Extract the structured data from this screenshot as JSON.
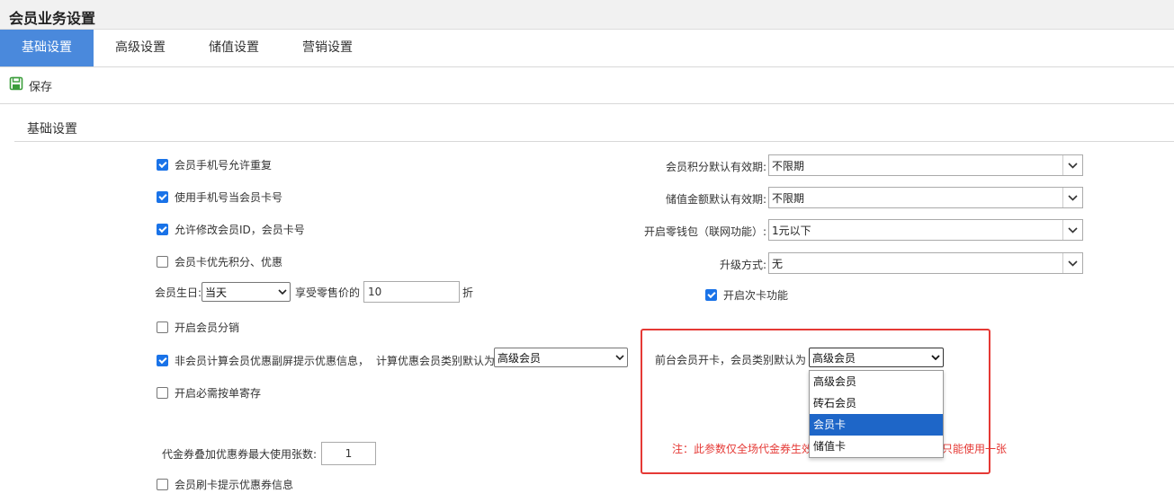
{
  "window": {
    "title": "会员业务设置"
  },
  "tabs": [
    "基础设置",
    "高级设置",
    "储值设置",
    "营销设置"
  ],
  "toolbar": {
    "save_label": "保存"
  },
  "section": {
    "title": "基础设置"
  },
  "left": {
    "cb1": {
      "label": "会员手机号允许重复",
      "checked": true
    },
    "cb2": {
      "label": "使用手机号当会员卡号",
      "checked": true
    },
    "cb3": {
      "label": "允许修改会员ID，会员卡号",
      "checked": true
    },
    "cb4": {
      "label": "会员卡优先积分、优惠",
      "checked": false
    },
    "birthday": {
      "label": "会员生日:",
      "select": "当天",
      "price_label": "享受零售价的",
      "price_value": "10",
      "unit": "折"
    },
    "cb5": {
      "label": "开启会员分销",
      "checked": false
    },
    "cb6": {
      "label": "非会员计算会员优惠副屏提示优惠信息，",
      "checked": true,
      "type_label": "计算优惠会员类别默认为",
      "type_select": "高级会员"
    },
    "cb7": {
      "label": "开启必需按单寄存",
      "checked": false
    },
    "coupon": {
      "label": "代金券叠加优惠券最大使用张数:",
      "value": "1"
    },
    "cb8": {
      "label": "会员刷卡提示优惠券信息",
      "checked": false
    }
  },
  "right": {
    "points_validity": {
      "label": "会员积分默认有效期:",
      "value": "不限期"
    },
    "stored_validity": {
      "label": "储值金额默认有效期:",
      "value": "不限期"
    },
    "wallet": {
      "label": "开启零钱包（联网功能）:",
      "value": "1元以下"
    },
    "upgrade": {
      "label": "升级方式:",
      "value": "无"
    },
    "subcard": {
      "label": "开启次卡功能",
      "checked": true
    },
    "frontdesk": {
      "label": "前台会员开卡，会员类别默认为",
      "value": "高级会员"
    },
    "dropdown_options": [
      "高级会员",
      "砖石会员",
      "会员卡",
      "储值卡"
    ],
    "dropdown_highlighted": "会员卡",
    "note_head": "注：此参数仅全场代金券生效",
    "note_tail": "只能使用一张"
  },
  "colors": {
    "tab_active": "#4a89dc",
    "highlight_box": "#e53935",
    "checkbox": "#1a73e8",
    "option_selected": "#1e66c8"
  }
}
